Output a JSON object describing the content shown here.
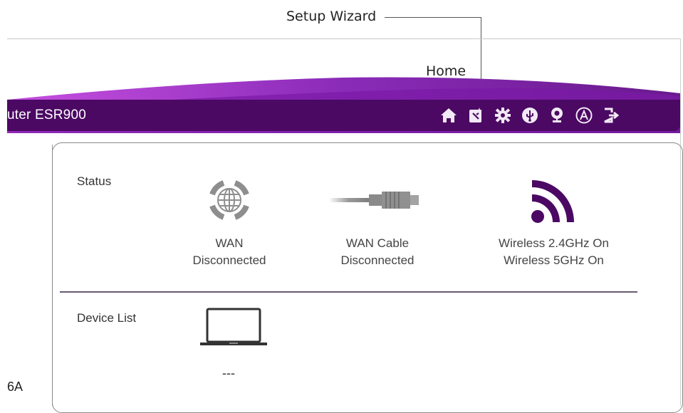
{
  "callouts": {
    "setup_wizard": "Setup Wizard",
    "home": "Home"
  },
  "header": {
    "product_name": "uter ESR900",
    "brand_color": "#4b0963",
    "accent_color": "#8a2bb8",
    "nav_icons": [
      "home-icon",
      "setup-wizard-icon",
      "gear-icon",
      "usb-icon",
      "webcam-icon",
      "a-icon",
      "logout-icon"
    ]
  },
  "sidebar": {
    "partial_text": "6A"
  },
  "status": {
    "label": "Status",
    "items": [
      {
        "icon": "globe-icon",
        "line1": "WAN",
        "line2": "Disconnected"
      },
      {
        "icon": "cable-icon",
        "line1": "WAN Cable",
        "line2": "Disconnected"
      },
      {
        "icon": "wifi-icon",
        "line1": "Wireless 2.4GHz On",
        "line2": "Wireless 5GHz On"
      }
    ]
  },
  "device_list": {
    "label": "Device List",
    "device_value": "---"
  }
}
